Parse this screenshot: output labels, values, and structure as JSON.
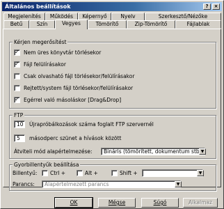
{
  "window": {
    "title": "Általános beállítások",
    "help": "?",
    "close": "×"
  },
  "tabs_back": [
    "Megjelenítés",
    "Működés",
    "Képernyő",
    "Nyelv",
    "Szerkesztő/Nézőke"
  ],
  "tabs_front": [
    "Betű",
    "Szín",
    "Vegyes",
    "Tömörítő",
    "Zip-Tömörítő",
    "Fájlablak"
  ],
  "active_tab": "Vegyes",
  "confirm_group": {
    "title": "Kérjen megerősítést",
    "items": [
      {
        "label": "Nem üres könyvtár törlésekor",
        "checked": true
      },
      {
        "label": "Fájl felülírásakor",
        "checked": true
      },
      {
        "label": "Csak olvasható fájl törlésekor/felülírásakor",
        "checked": false
      },
      {
        "label": "Rejtett/system fájl törlésekor/felülírásakor",
        "checked": false
      },
      {
        "label": "Egérrel való másoláskor [Drag&Drop]",
        "checked": true
      }
    ]
  },
  "ftp_group": {
    "title": "FTP",
    "retries_value": "10",
    "retries_label": "Újrapróbálkozások száma foglalt FTP szervernél",
    "wait_value": "5",
    "wait_label": "másodperc szünet a hívások között",
    "transfer_label": "Átviteli mód alapértelmezése:",
    "transfer_value": "Bináris (tömörített, dokumentum stb.)"
  },
  "hotkey_group": {
    "title": "Gyorbillentyűk beállítása",
    "key_label": "Billentyű:",
    "ctrl": "Ctrl +",
    "alt": "Alt +",
    "shift": "Shift +",
    "command_label": "Parancs:",
    "command_value": "Alapértelmezett parancs"
  },
  "buttons": {
    "ok": "OK",
    "cancel": "Mégse",
    "help": "Súgó",
    "apply": "Alkalmaz"
  }
}
